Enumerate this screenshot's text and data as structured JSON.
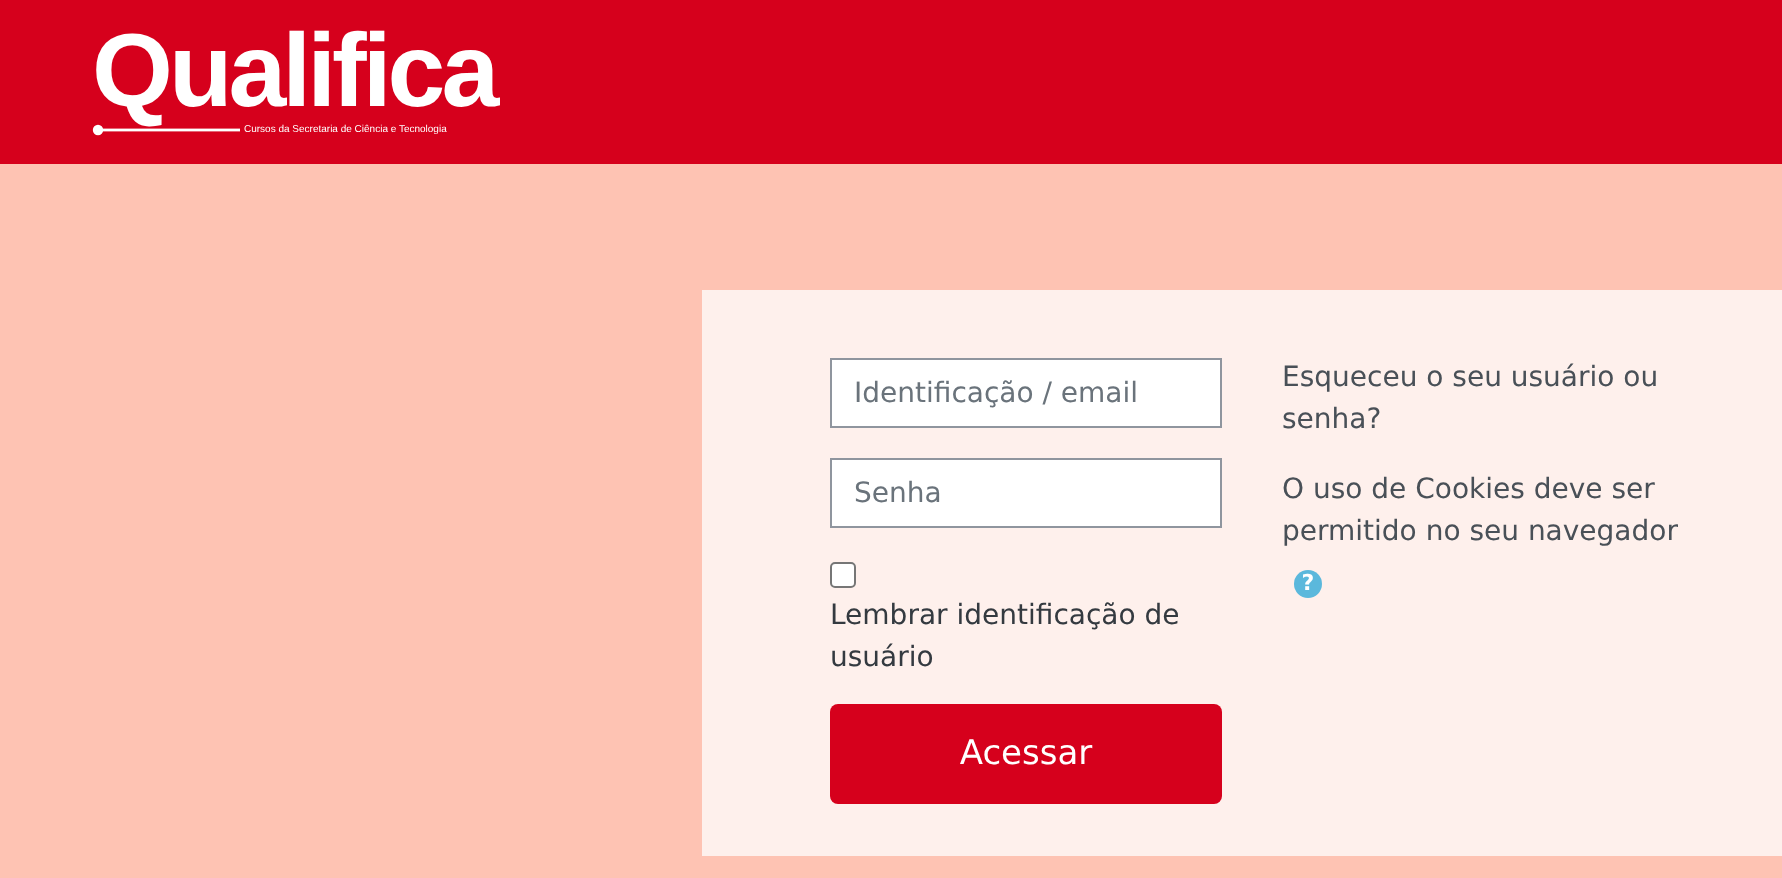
{
  "header": {
    "logo": "Qualifica",
    "tagline": "Cursos da Secretaria de Ciência e Tecnologia"
  },
  "login": {
    "username": {
      "placeholder": "Identificação / email"
    },
    "password": {
      "placeholder": "Senha"
    },
    "remember": {
      "label": "Lembrar identificação de usuário",
      "checked": false
    },
    "submit": "Acessar",
    "forgot_link": "Esqueceu o seu usuário ou senha?",
    "cookies_notice": "O uso de Cookies deve ser permitido no seu navegador",
    "help_icon": "?"
  }
}
